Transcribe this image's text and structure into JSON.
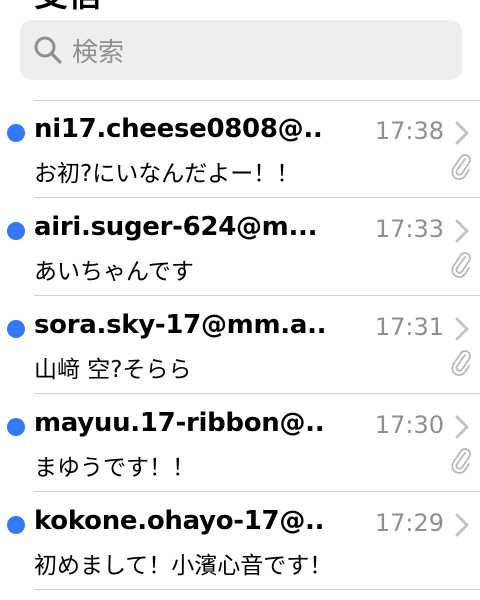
{
  "header": {
    "title_fragment": "受信"
  },
  "search": {
    "placeholder": "検索",
    "icon": "search-icon"
  },
  "messages": [
    {
      "sender": "ni17.cheese0808@...",
      "time": "17:38",
      "preview": "お初?にいなんだよー！！",
      "unread": true,
      "attachment": true
    },
    {
      "sender": "airi.suger-624@m...",
      "time": "17:33",
      "preview": "あいちゃんです",
      "unread": true,
      "attachment": true
    },
    {
      "sender": "sora.sky-17@mm.a...",
      "time": "17:31",
      "preview": "山﨑 空?そらら",
      "unread": true,
      "attachment": true
    },
    {
      "sender": "mayuu.17-ribbon@...",
      "time": "17:30",
      "preview": "まゆうです！！",
      "unread": true,
      "attachment": true
    },
    {
      "sender": "kokone.ohayo-17@...",
      "time": "17:29",
      "preview": "初めまして！小濱心音です！",
      "unread": true,
      "attachment": false
    }
  ],
  "colors": {
    "unread_dot": "#3478f6",
    "secondary_text": "#8e8e93",
    "search_bg": "#eeeeef",
    "divider": "#d1d1d6"
  }
}
